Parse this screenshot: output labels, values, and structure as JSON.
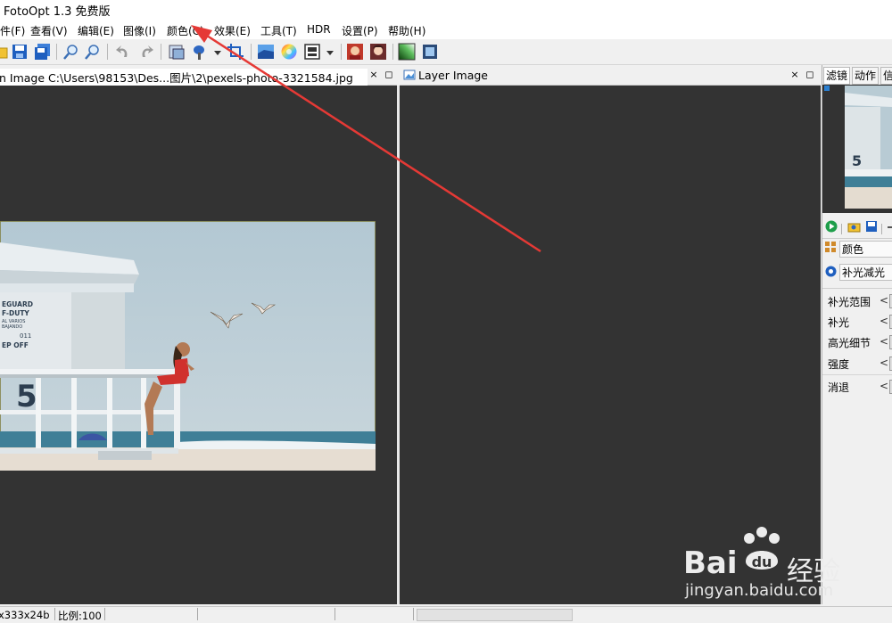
{
  "app": {
    "title": "FotoOpt 1.3 免费版"
  },
  "menu": [
    "件(F)",
    "查看(V)",
    "编辑(E)",
    "图像(I)",
    "颜色(C)",
    "效果(E)",
    "工具(T)",
    "HDR",
    "设置(P)",
    "帮助(H)"
  ],
  "main_panel": {
    "title": "n Image C:\\Users\\98153\\Des...图片\\2\\pexels-photo-3321584.jpg"
  },
  "layer_panel": {
    "title": "Layer Image"
  },
  "window_controls": {
    "close": "×",
    "restore": "◻"
  },
  "photo": {
    "sign_lines": [
      "EGUARD",
      "F-DUTY",
      "AL VARIOS",
      "BAJANDO",
      "011",
      "EP OFF"
    ],
    "tower_number": "5",
    "thumb_number": "5"
  },
  "right_panel": {
    "tabs": [
      "滤镜",
      "动作",
      "信"
    ],
    "category": "颜色",
    "selected_filter": "补光减光",
    "params": [
      {
        "label": "补光范围",
        "arrow": "<"
      },
      {
        "label": "补光",
        "arrow": "<"
      },
      {
        "label": "高光细节",
        "arrow": "<"
      },
      {
        "label": "强度",
        "arrow": "<"
      },
      {
        "label": "消退",
        "arrow": "<"
      }
    ]
  },
  "status": {
    "dims": "x333x24b",
    "scale": "比例:100"
  },
  "watermark": {
    "brand": "Bai",
    "brand_cn": "经验",
    "url": "jingyan.baidu.com"
  },
  "colors": {
    "canvas": "#333333",
    "arrow": "#e53935",
    "accent": "#2b7fd0"
  }
}
